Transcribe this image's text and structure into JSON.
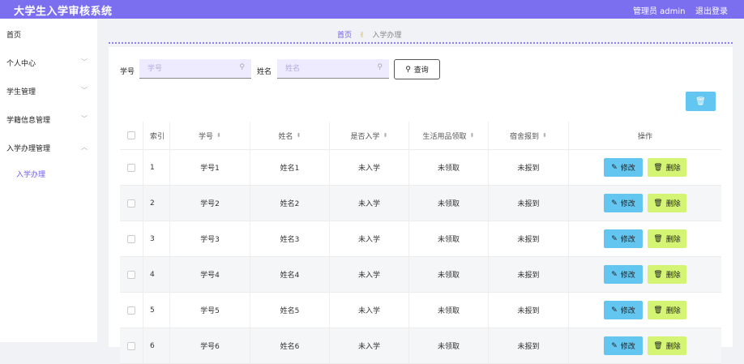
{
  "header": {
    "title": "大学生入学审核系统",
    "admin_label": "管理员 admin",
    "logout_label": "退出登录"
  },
  "sidebar": {
    "items": [
      {
        "label": "首页"
      },
      {
        "label": "个人中心"
      },
      {
        "label": "学生管理"
      },
      {
        "label": "学籍信息管理"
      },
      {
        "label": "入学办理管理"
      }
    ],
    "subitem": {
      "label": "入学办理"
    }
  },
  "breadcrumb": {
    "home": "首页",
    "current": "入学办理"
  },
  "search": {
    "xuehao_label": "学号",
    "xuehao_placeholder": "学号",
    "xingming_label": "姓名",
    "xingming_placeholder": "姓名",
    "query_label": "查询"
  },
  "table": {
    "columns": [
      "索引",
      "学号",
      "姓名",
      "是否入学",
      "生活用品领取",
      "宿舍报到",
      "操作"
    ],
    "edit_label": "修改",
    "delete_label": "删除",
    "rows": [
      {
        "index": "1",
        "xuehao": "学号1",
        "xingming": "姓名1",
        "ruxue": "未入学",
        "lingqu": "未领取",
        "baodao": "未报到"
      },
      {
        "index": "2",
        "xuehao": "学号2",
        "xingming": "姓名2",
        "ruxue": "未入学",
        "lingqu": "未领取",
        "baodao": "未报到"
      },
      {
        "index": "3",
        "xuehao": "学号3",
        "xingming": "姓名3",
        "ruxue": "未入学",
        "lingqu": "未领取",
        "baodao": "未报到"
      },
      {
        "index": "4",
        "xuehao": "学号4",
        "xingming": "姓名4",
        "ruxue": "未入学",
        "lingqu": "未领取",
        "baodao": "未报到"
      },
      {
        "index": "5",
        "xuehao": "学号5",
        "xingming": "姓名5",
        "ruxue": "未入学",
        "lingqu": "未领取",
        "baodao": "未报到"
      },
      {
        "index": "6",
        "xuehao": "学号6",
        "xingming": "姓名6",
        "ruxue": "未入学",
        "lingqu": "未领取",
        "baodao": "未报到"
      }
    ]
  },
  "colors": {
    "topbar": "#7c6fef",
    "accent": "#6c5cf0",
    "edit_button": "#63c6f0",
    "delete_button": "#d4f573"
  }
}
